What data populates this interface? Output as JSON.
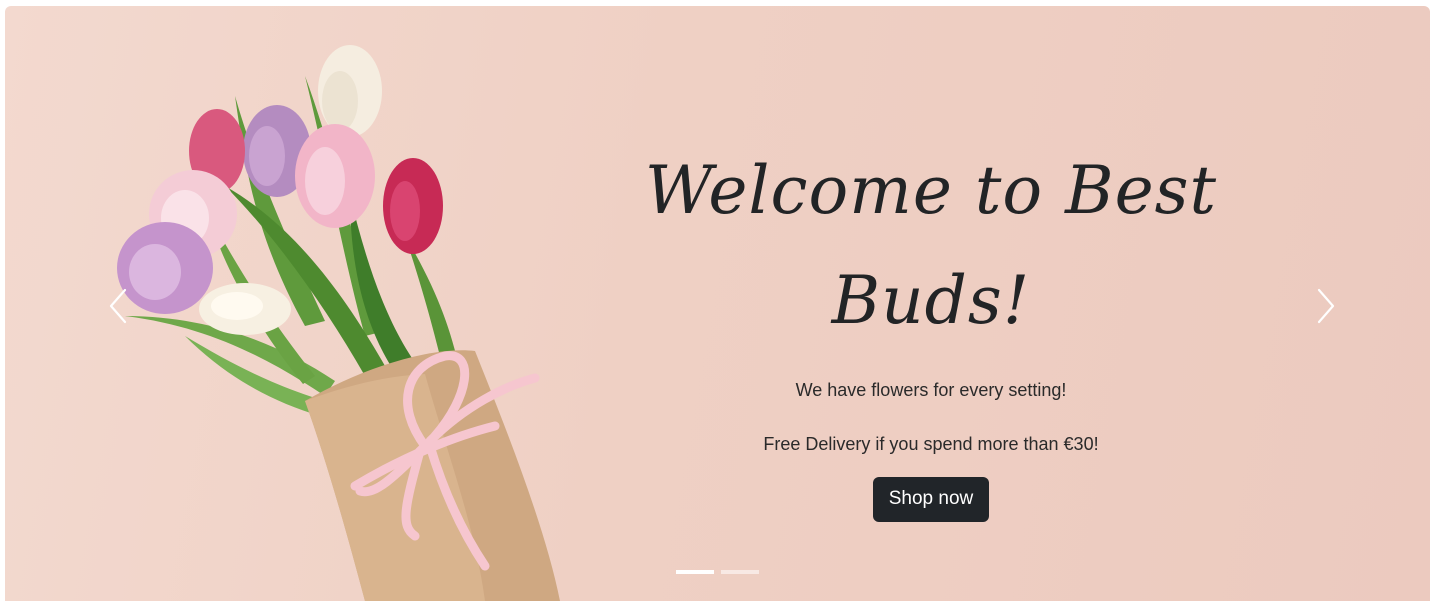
{
  "hero": {
    "title": "Welcome to Best Buds!",
    "subtitle": "We have flowers for every setting!",
    "promo": "Free Delivery if you spend more than €30!",
    "cta_label": "Shop now"
  },
  "carousel": {
    "prev_icon": "chevron-left-icon",
    "next_icon": "chevron-right-icon",
    "slide_count": 2,
    "active_slide": 1
  },
  "colors": {
    "background": "#efd0c4",
    "button": "#212529",
    "button_text": "#ffffff",
    "title_text": "#222426"
  }
}
